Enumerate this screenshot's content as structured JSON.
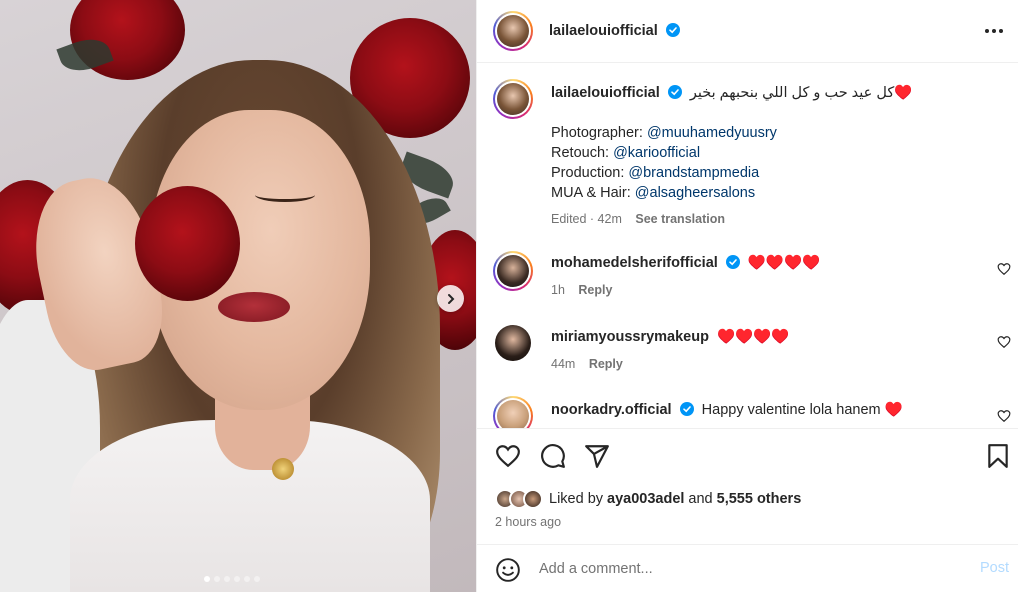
{
  "post": {
    "username": "lailaelouiofficial",
    "more_icon": "more-horizontal-icon",
    "image_dots": 6,
    "active_dot": 0
  },
  "caption": {
    "username": "lailaelouiofficial",
    "text": "♥️كل عيد حب و كل اللي بنحبهم بخير",
    "credits": [
      {
        "label": "Photographer:",
        "handle": "@muuhamedyuusry"
      },
      {
        "label": "Retouch:",
        "handle": "@karioofficial"
      },
      {
        "label": "Production:",
        "handle": "@brandstampmedia"
      },
      {
        "label": "MUA & Hair:",
        "handle": "@alsagheersalons"
      }
    ],
    "edited": "Edited · 42m",
    "see_translation": "See translation"
  },
  "comments": [
    {
      "username": "mohamedelsherifofficial",
      "verified": true,
      "text": "♥️♥️♥️♥️",
      "time": "1h",
      "reply": "Reply"
    },
    {
      "username": "miriamyoussrymakeup",
      "verified": false,
      "text": "♥️♥️♥️♥️",
      "time": "44m",
      "reply": "Reply"
    },
    {
      "username": "noorkadry.official",
      "verified": true,
      "text": "Happy valentine lola hanem ♥️"
    }
  ],
  "actions": {
    "liked_by_prefix": "Liked by",
    "liked_by_user": "aya003adel",
    "and": "and",
    "others": "5,555 others",
    "time_ago": "2 hours ago"
  },
  "add_comment": {
    "placeholder": "Add a comment...",
    "post_label": "Post"
  },
  "colors": {
    "link": "#00376b",
    "verified": "#0095f6",
    "post_disabled": "#b3dbff"
  }
}
